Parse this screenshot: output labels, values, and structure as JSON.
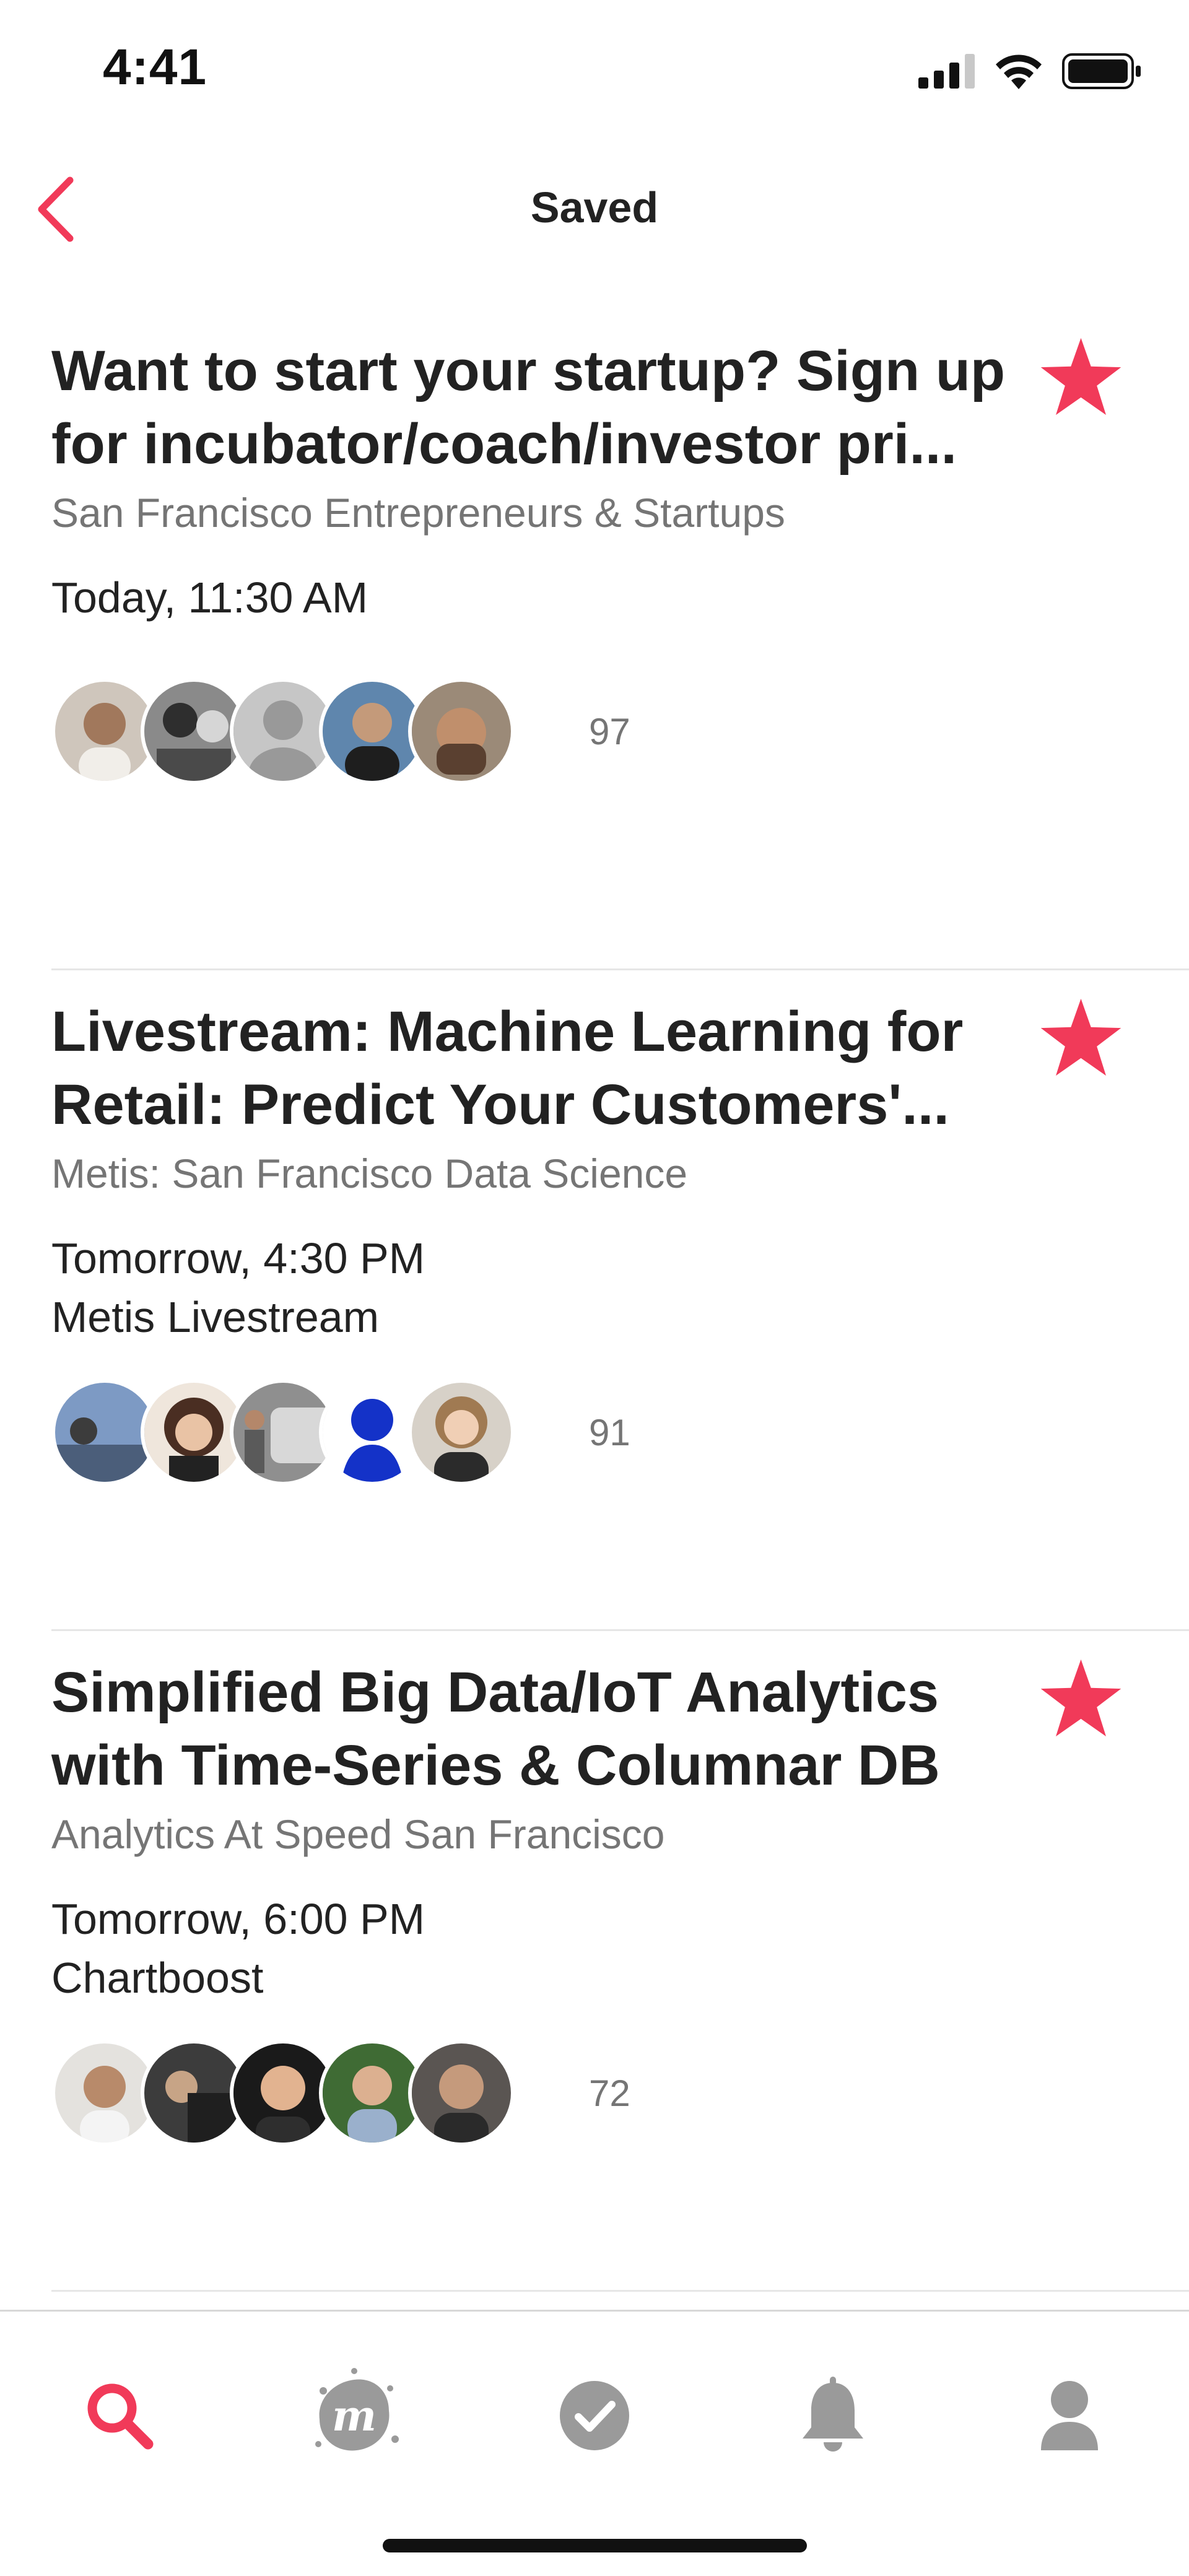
{
  "status_bar": {
    "time": "4:41"
  },
  "nav": {
    "title": "Saved"
  },
  "colors": {
    "accent": "#f13a59",
    "tab_inactive": "#9a9a9a",
    "secondary_text": "#757575"
  },
  "events": [
    {
      "title": "Want to start your startup? Sign up for incubator/coach/investor pri...",
      "group": "San Francisco Entrepreneurs & Startups",
      "time": "Today, 11:30 AM",
      "venue": "",
      "attendee_count": "97",
      "saved": true
    },
    {
      "title": "Livestream: Machine Learning for Retail: Predict Your Customers'...",
      "group": "Metis: San Francisco Data Science",
      "time": "Tomorrow, 4:30 PM",
      "venue": "Metis Livestream",
      "attendee_count": "91",
      "saved": true
    },
    {
      "title": "Simplified Big Data/IoT Analytics with Time-Series & Columnar DB",
      "group": "Analytics At Speed San Francisco",
      "time": "Tomorrow, 6:00 PM",
      "venue": "Chartboost",
      "attendee_count": "72",
      "saved": true
    }
  ],
  "tabs": [
    {
      "icon": "search-icon",
      "active": true
    },
    {
      "icon": "meetup-logo-icon",
      "active": false
    },
    {
      "icon": "checkmark-circle-icon",
      "active": false
    },
    {
      "icon": "bell-icon",
      "active": false
    },
    {
      "icon": "profile-icon",
      "active": false
    }
  ]
}
